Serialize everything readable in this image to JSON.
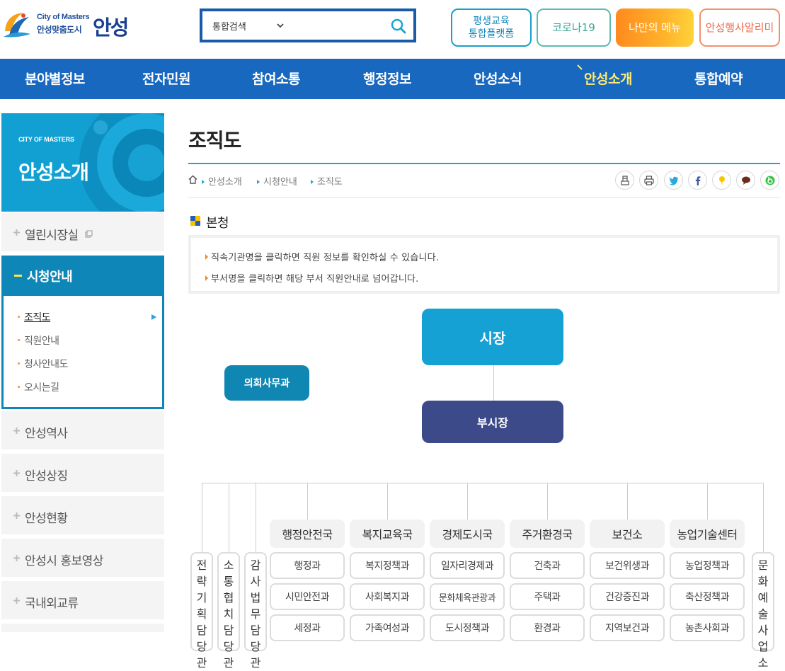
{
  "header": {
    "logo": {
      "english": "City of Masters",
      "slogan": "안성맞춤도시",
      "name": "안성"
    },
    "search": {
      "scope": "통합검색",
      "query": ""
    },
    "buttons": {
      "lifelong_line1": "평생교육",
      "lifelong_line2": "통합플랫폼",
      "corona": "코로나19",
      "my_menu": "나만의 메뉴",
      "event_alert": "안성행사알리미"
    }
  },
  "gnb": {
    "items": [
      "분야별정보",
      "전자민원",
      "참여소통",
      "행정정보",
      "안성소식",
      "안성소개",
      "통합예약"
    ],
    "active": "안성소개"
  },
  "sidebar": {
    "head_english": "CITY OF MASTERS",
    "head_title": "안성소개",
    "items": [
      "열린시장실",
      "시청안내",
      "안성역사",
      "안성상징",
      "안성현황",
      "안성시 홍보영상",
      "국내외교류"
    ],
    "sub_items": [
      "조직도",
      "직원안내",
      "청사안내도",
      "오시는길"
    ]
  },
  "content": {
    "title": "조직도",
    "breadcrumb": [
      "안성소개",
      "시청안내",
      "조직도"
    ],
    "section_title": "본청",
    "notices": [
      "직속기관명을 클릭하면 직원 정보를 확인하실 수 있습니다.",
      "부서명을 클릭하면 해당 부서 직원안내로 넘어갑니다."
    ]
  },
  "org": {
    "mayor": "시장",
    "vice_mayor": "부시장",
    "council_office": "의회사무과",
    "vertical_units": [
      "전략기획담당관",
      "소통협치담당관",
      "감사법무담당관",
      "문화예술사업소"
    ],
    "bureaus": [
      {
        "name": "행정안전국",
        "depts": [
          "행정과",
          "시민안전과",
          "세정과"
        ]
      },
      {
        "name": "복지교육국",
        "depts": [
          "복지정책과",
          "사회복지과",
          "가족여성과"
        ]
      },
      {
        "name": "경제도시국",
        "depts": [
          "일자리경제과",
          "문화체육관광과",
          "도시정책과"
        ]
      },
      {
        "name": "주거환경국",
        "depts": [
          "건축과",
          "주택과",
          "환경과"
        ]
      },
      {
        "name": "보건소",
        "depts": [
          "보건위생과",
          "건강증진과",
          "지역보건과"
        ]
      },
      {
        "name": "농업기술센터",
        "depts": [
          "농업정책과",
          "축산정책과",
          "농촌사회과"
        ]
      }
    ]
  },
  "colors": {
    "gnb": "#1968bf",
    "accent": "#15a1d4",
    "vice_mayor": "#3d4a8a",
    "active_gnb_text": "#ffe96b"
  }
}
